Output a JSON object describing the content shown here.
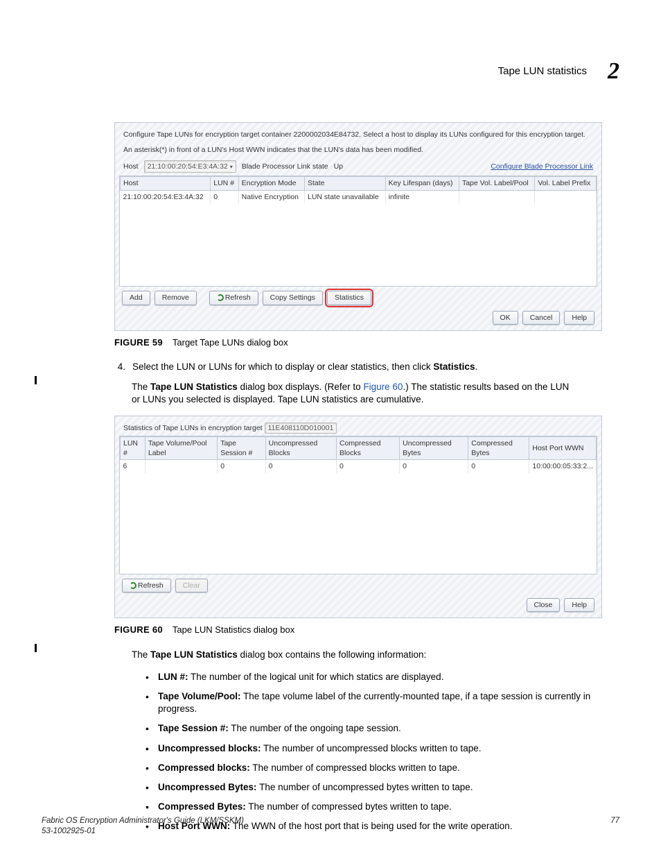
{
  "header": {
    "title": "Tape LUN statistics",
    "chapter": "2"
  },
  "fig59": {
    "label": "FIGURE 59",
    "caption": "Target Tape LUNs dialog box",
    "infoLine1": "Configure Tape LUNs for encryption target container 2200002034E84732. Select a host to display its LUNs configured for this encryption target.",
    "infoLine2": "An asterisk(*) in front of a LUN's Host WWN indicates that the LUN's data has been modified.",
    "hostLabel": "Host",
    "hostValue": "21:10:00:20:54:E3:4A:32",
    "linkStateLabel": "Blade Processor Link state",
    "linkStateValue": "Up",
    "configLink": "Configure Blade Processor Link",
    "cols": {
      "c1": "Host",
      "c2": "LUN #",
      "c3": "Encryption Mode",
      "c4": "State",
      "c5": "Key Lifespan (days)",
      "c6": "Tape Vol. Label/Pool",
      "c7": "Vol. Label Prefix"
    },
    "row": {
      "host": "21:10:00:20:54:E3:4A:32",
      "lun": "0",
      "mode": "Native Encryption",
      "state": "LUN state unavailable",
      "life": "infinite",
      "pool": "",
      "prefix": ""
    },
    "buttons": {
      "add": "Add",
      "remove": "Remove",
      "refresh": "Refresh",
      "copy": "Copy Settings",
      "stats": "Statistics",
      "ok": "OK",
      "cancel": "Cancel",
      "help": "Help"
    }
  },
  "step4": {
    "num": "4.",
    "textPre": "Select the LUN or LUNs for which to display or clear statistics, then click ",
    "textBold": "Statistics",
    "textPost": "."
  },
  "para_after_step": {
    "pre": "The ",
    "bold": "Tape LUN Statistics",
    "mid": " dialog box displays. (Refer to ",
    "link": "Figure 60",
    "post": ".) The statistic results based on the LUN or LUNs you selected is displayed. Tape LUN statistics are cumulative."
  },
  "fig60": {
    "label": "FIGURE 60",
    "caption": "Tape LUN Statistics dialog box",
    "titleLine": "Statistics of Tape LUNs in encryption target",
    "targetId": "11E408110D010001",
    "cols": {
      "c1": "LUN #",
      "c2": "Tape Volume/Pool Label",
      "c3": "Tape Session #",
      "c4": "Uncompressed Blocks",
      "c5": "Compressed Blocks",
      "c6": "Uncompressed Bytes",
      "c7": "Compressed Bytes",
      "c8": "Host Port WWN"
    },
    "row": {
      "lun": "6",
      "label": "",
      "sess": "0",
      "ub": "0",
      "cb": "0",
      "uby": "0",
      "cby": "0",
      "hp": "10:00:00:05:33:2..."
    },
    "buttons": {
      "refresh": "Refresh",
      "clear": "Clear",
      "close": "Close",
      "help": "Help"
    }
  },
  "desc_intro": {
    "pre": "The ",
    "bold": "Tape LUN Statistics",
    "post": " dialog box contains the following information:"
  },
  "bullets": [
    {
      "term": "LUN #:",
      "def": " The number of the logical unit for which statics are displayed."
    },
    {
      "term": "Tape Volume/Pool:",
      "def": " The tape volume label of the currently-mounted tape, if a tape session is currently in progress."
    },
    {
      "term": "Tape Session #:",
      "def": " The number of the ongoing tape session."
    },
    {
      "term": "Uncompressed blocks:",
      "def": " The number of uncompressed blocks written to tape."
    },
    {
      "term": "Compressed blocks:",
      "def": " The number of compressed blocks written to tape."
    },
    {
      "term": "Uncompressed Bytes:",
      "def": " The number of uncompressed bytes written to tape."
    },
    {
      "term": "Compressed Bytes:",
      "def": " The number of compressed bytes written to tape."
    },
    {
      "term": "Host Port WWN:",
      "def": " The WWN of the host port that is being used for the write operation."
    }
  ],
  "footer": {
    "left1": "Fabric OS Encryption Administrator's Guide  (LKM/SSKM)",
    "left2": "53-1002925-01",
    "right": "77"
  }
}
